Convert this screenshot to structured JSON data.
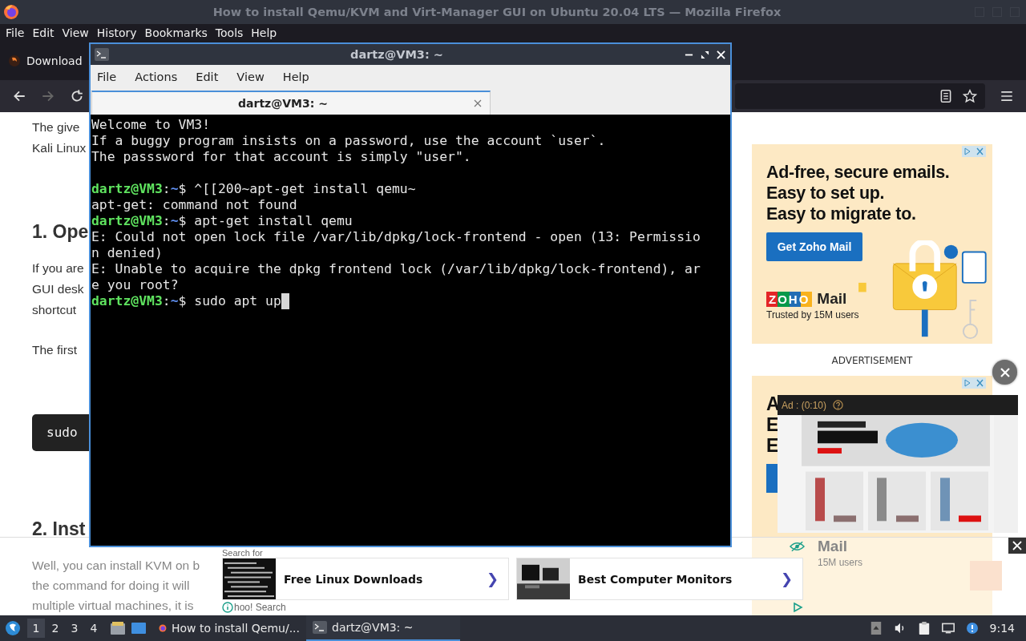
{
  "firefox": {
    "title": "How to install Qemu/KVM and Virt-Manager GUI on Ubuntu 20.04 LTS — Mozilla Firefox",
    "menu": [
      "File",
      "Edit",
      "View",
      "History",
      "Bookmarks",
      "Tools",
      "Help"
    ],
    "tab": {
      "label": "Download"
    },
    "nav": {
      "forward_disabled": true
    },
    "article": [
      {
        "kind": "paragraph",
        "lines": [
          "The give",
          "Kali Linux"
        ]
      },
      {
        "kind": "heading",
        "text": "1. Ope"
      },
      {
        "kind": "paragraph",
        "lines": [
          "If you are",
          "GUI desk",
          "shortcut"
        ]
      },
      {
        "kind": "paragraph",
        "lines": [
          "The first"
        ]
      },
      {
        "kind": "code",
        "text": "sudo"
      },
      {
        "kind": "heading",
        "text": "2. Inst"
      },
      {
        "kind": "faded",
        "lines": [
          "Well, you can install KVM on b",
          "the command for doing it will",
          "multiple virtual machines, it is"
        ]
      }
    ],
    "side_ad": {
      "headline": [
        "Ad-free, secure emails.",
        "Easy to set up.",
        "Easy to migrate to."
      ],
      "button": "Get Zoho Mail",
      "logo": "ZOHO",
      "brand": "Mail",
      "tagline": "Trusted by 15M users"
    },
    "ad_label": "ADVERTISEMENT",
    "side_ad_2": {
      "letters": [
        "A",
        "E",
        "E"
      ],
      "brand": "Mail",
      "tagline": "15M users"
    },
    "video_ad": {
      "label": "Ad : (0:10)",
      "kind": "picture"
    },
    "bottom_ad": {
      "heading": "Search for",
      "cards": [
        {
          "label": "Free Linux Downloads",
          "arrow": "❯"
        },
        {
          "label": "Best Computer Monitors",
          "arrow": "❯"
        }
      ],
      "footer": "hoo! Search"
    }
  },
  "terminal": {
    "title": "dartz@VM3: ~",
    "menu": [
      "File",
      "Actions",
      "Edit",
      "View",
      "Help"
    ],
    "tab": {
      "label": "dartz@VM3: ~"
    },
    "lines": [
      {
        "kind": "output",
        "text": "Welcome to VM3!"
      },
      {
        "kind": "output",
        "text": "If a buggy program insists on a password, use the account `user`."
      },
      {
        "kind": "output",
        "text": "The passsword for that account is simply \"user\"."
      },
      {
        "kind": "blank"
      },
      {
        "kind": "prompt",
        "user": "dartz@VM3",
        "sep": ":",
        "path": "~",
        "command": "$ ^[[200~apt-get install qemu~",
        "cursor": false
      },
      {
        "kind": "output",
        "text": "apt-get: command not found"
      },
      {
        "kind": "prompt",
        "user": "dartz@VM3",
        "sep": ":",
        "path": "~",
        "command": "$ apt-get install qemu",
        "cursor": false
      },
      {
        "kind": "output",
        "text": "E: Could not open lock file /var/lib/dpkg/lock-frontend - open (13: Permissio"
      },
      {
        "kind": "output",
        "text": "n denied)"
      },
      {
        "kind": "output",
        "text": "E: Unable to acquire the dpkg frontend lock (/var/lib/dpkg/lock-frontend), ar"
      },
      {
        "kind": "output",
        "text": "e you root?"
      },
      {
        "kind": "prompt",
        "user": "dartz@VM3",
        "sep": ":",
        "path": "~",
        "command": "$ sudo apt up",
        "cursor": true
      }
    ]
  },
  "taskbar": {
    "workspaces": [
      {
        "label": "1",
        "selected": true
      },
      {
        "label": "2",
        "selected": false
      },
      {
        "label": "3",
        "selected": false
      },
      {
        "label": "4",
        "selected": false
      }
    ],
    "tasks": [
      {
        "label": "How to install Qemu/...",
        "kind": "browser",
        "selected": false
      },
      {
        "label": "dartz@VM3: ~",
        "kind": "terminal",
        "selected": true
      }
    ],
    "clock": "9:14"
  }
}
